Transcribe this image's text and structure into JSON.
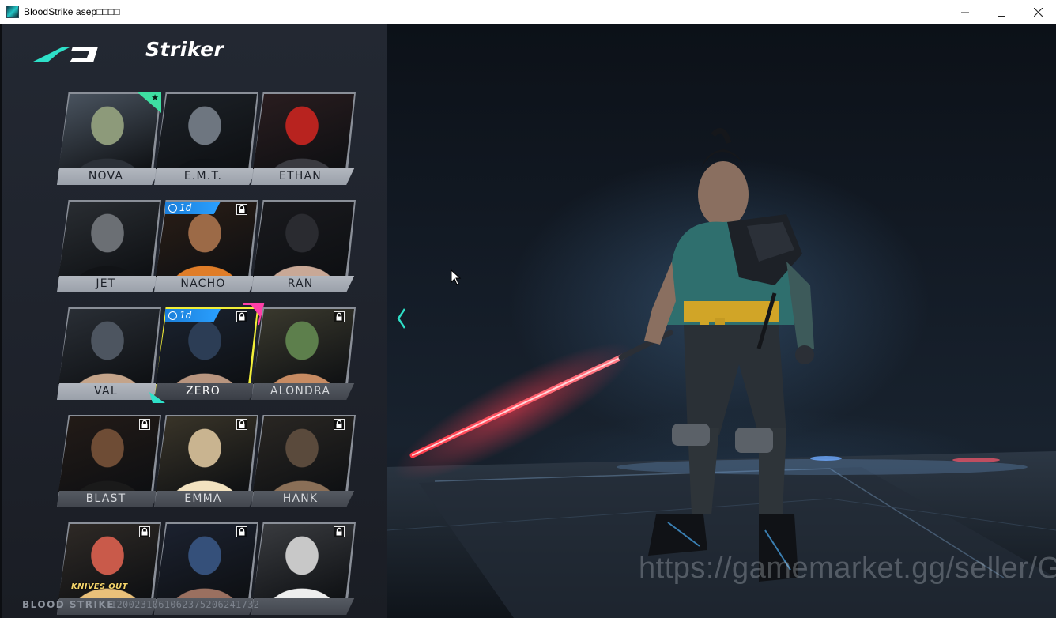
{
  "window": {
    "title": "BloodStrike asep□□□□",
    "minimize_label": "—",
    "maximize_label": "☐",
    "close_label": "✕"
  },
  "header": {
    "title": "Striker"
  },
  "roster": [
    {
      "name": "NOVA",
      "state": "owned",
      "badge": "star"
    },
    {
      "name": "E.M.T.",
      "state": "owned"
    },
    {
      "name": "ETHAN",
      "state": "owned"
    },
    {
      "name": "JET",
      "state": "owned"
    },
    {
      "name": "NACHO",
      "state": "trial",
      "timer": "1d"
    },
    {
      "name": "RAN",
      "state": "owned"
    },
    {
      "name": "VAL",
      "state": "owned"
    },
    {
      "name": "ZERO",
      "state": "trial-selected",
      "timer": "1d"
    },
    {
      "name": "ALONDRA",
      "state": "locked"
    },
    {
      "name": "BLAST",
      "state": "locked"
    },
    {
      "name": "EMMA",
      "state": "locked"
    },
    {
      "name": "HANK",
      "state": "locked"
    },
    {
      "name": "",
      "state": "locked",
      "brand": "KNIVES OUT"
    },
    {
      "name": "",
      "state": "locked"
    },
    {
      "name": "",
      "state": "locked"
    }
  ],
  "footer": {
    "brand": "BLOOD STRIKE",
    "id": "1200231061062375206241732"
  },
  "watermark": "https://gamemarket.gg/seller/GameNews",
  "colors": {
    "accent_teal": "#2ee0c8",
    "selected_frame": "#f2ef38",
    "timer_blue": "#2aa0ff",
    "star_green": "#3ee0a2"
  }
}
